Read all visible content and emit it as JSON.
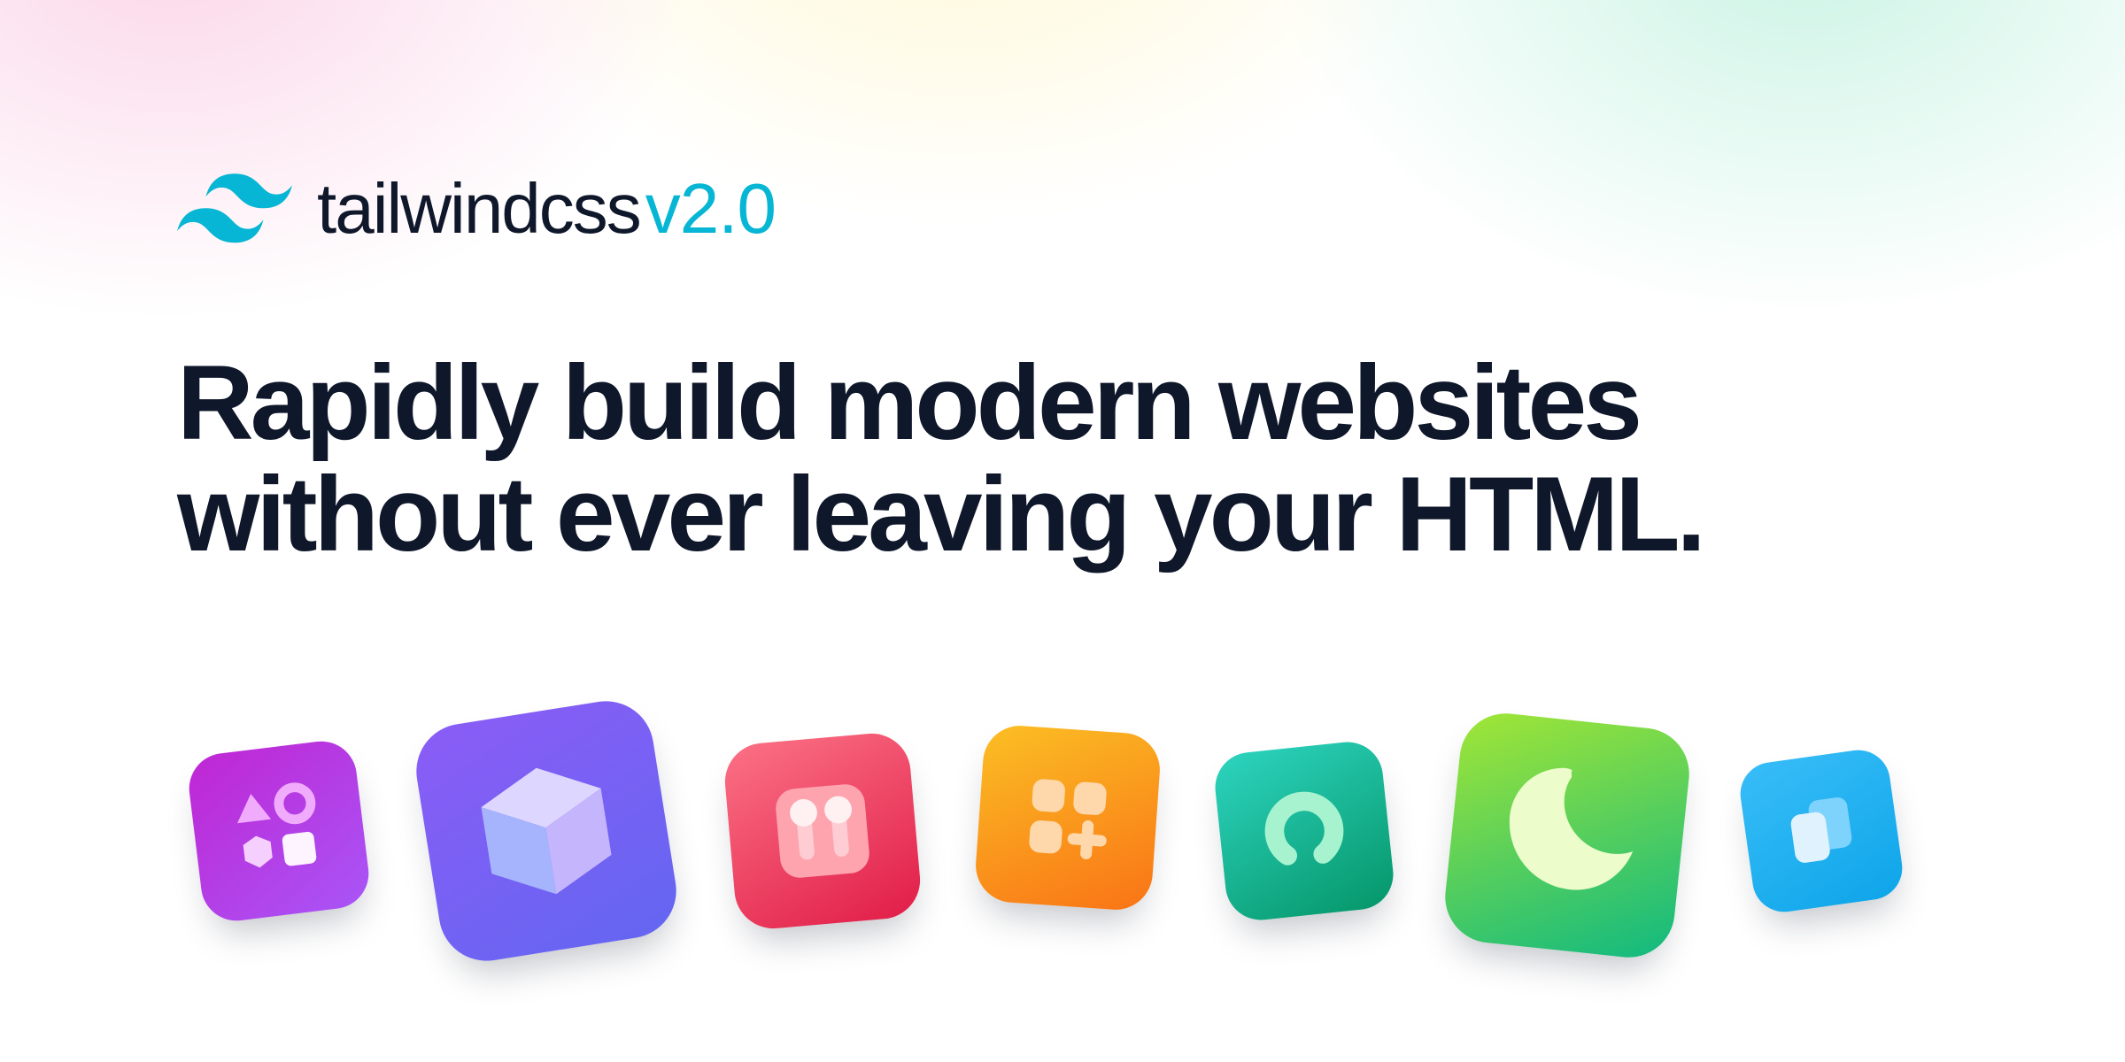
{
  "brand": {
    "name": "tailwindcss",
    "version": "v2.0"
  },
  "headline": "Rapidly build modern websites without ever leaving your HTML.",
  "feature_cards": [
    {
      "icon": "shapes-icon",
      "color_from": "#c026d3",
      "color_to": "#a855f7"
    },
    {
      "icon": "cube-icon",
      "color_from": "#8b5cf6",
      "color_to": "#6366f1"
    },
    {
      "icon": "sliders-icon",
      "color_from": "#fb7185",
      "color_to": "#e11d48"
    },
    {
      "icon": "grid-plus-icon",
      "color_from": "#fbbf24",
      "color_to": "#f97316"
    },
    {
      "icon": "ring-icon",
      "color_from": "#2dd4bf",
      "color_to": "#059669"
    },
    {
      "icon": "moon-icon",
      "color_from": "#a3e635",
      "color_to": "#10b981"
    },
    {
      "icon": "panels-icon",
      "color_from": "#38bdf8",
      "color_to": "#0ea5e9"
    }
  ],
  "colors": {
    "text": "#0f172a",
    "accent": "#06b6d4"
  }
}
